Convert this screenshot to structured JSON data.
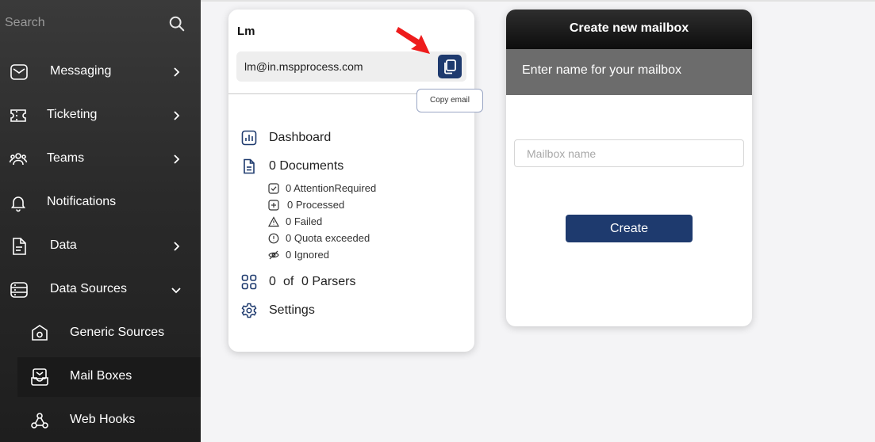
{
  "sidebar": {
    "search_placeholder": "Search",
    "items": [
      {
        "label": "Messaging",
        "icon": "envelope-icon",
        "chevron": "right"
      },
      {
        "label": "Ticketing",
        "icon": "ticket-icon",
        "chevron": "right"
      },
      {
        "label": "Teams",
        "icon": "users-icon",
        "chevron": "right"
      },
      {
        "label": "Notifications",
        "icon": "bell-icon"
      },
      {
        "label": "Data",
        "icon": "file-icon",
        "chevron": "right"
      },
      {
        "label": "Data Sources",
        "icon": "server-icon",
        "chevron": "down"
      },
      {
        "label": "Generic Sources",
        "icon": "home-hexagon-icon"
      },
      {
        "label": "Mail Boxes",
        "icon": "inbox-icon"
      },
      {
        "label": "Web Hooks",
        "icon": "webhook-icon"
      }
    ]
  },
  "account": {
    "name": "Lm",
    "email": "lm@in.mspprocess.com",
    "tooltip": "Copy email",
    "menu": {
      "dashboard": "Dashboard",
      "documents": "0 Documents",
      "parsers_count": "0",
      "parsers_of": "of",
      "parsers_total": "0 Parsers",
      "settings": "Settings"
    },
    "documents": [
      {
        "label": "0 AttentionRequired",
        "icon": "check-square-icon"
      },
      {
        "label": "0 Processed",
        "icon": "plus-square-icon"
      },
      {
        "label": "0 Failed",
        "icon": "warning-triangle-icon"
      },
      {
        "label": "0 Quota exceeded",
        "icon": "alert-circle-icon"
      },
      {
        "label": "0 Ignored",
        "icon": "eye-off-icon"
      }
    ]
  },
  "mailbox": {
    "title": "Create new mailbox",
    "subtitle": "Enter name for your mailbox",
    "input_placeholder": "Mailbox name",
    "create_label": "Create"
  },
  "colors": {
    "accent": "#1e3a6e",
    "sidebar_bg": "#2a2a2a",
    "subheader_bg": "#6c6c6c"
  }
}
